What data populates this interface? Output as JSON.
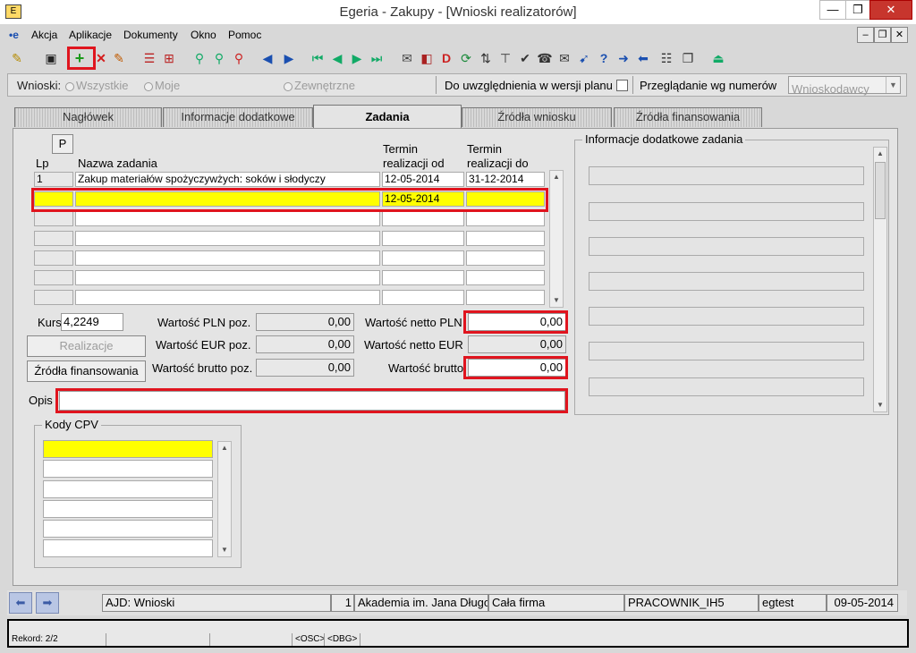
{
  "window": {
    "title": "Egeria - Zakupy - [Wnioski realizatorów]",
    "minimize": "—",
    "restore": "❐",
    "close": "✕"
  },
  "menu": [
    "Akcja",
    "Aplikacje",
    "Dokumenty",
    "Okno",
    "Pomoc"
  ],
  "mdi": {
    "minimize": "–",
    "restore": "❐",
    "close": "✕"
  },
  "filter": {
    "label": "Wnioski:",
    "opt_all": "Wszystkie",
    "opt_mine": "Moje",
    "opt_external": "Zewnętrzne",
    "plan_label": "Do uwzględnienia w wersji planu",
    "browse_label": "Przeglądanie wg numerów",
    "browse_value": "Wnioskodawcy"
  },
  "tabs": [
    "Nagłówek",
    "Informacje dodatkowe",
    "Zadania",
    "Źródła wniosku",
    "Źródła finansowania"
  ],
  "tasks": {
    "p_button": "P",
    "col_lp": "Lp",
    "col_name": "Nazwa zadania",
    "col_from_1": "Termin",
    "col_from_2": "realizacji od",
    "col_to_1": "Termin",
    "col_to_2": "realizacji do",
    "rows": [
      {
        "lp": "1",
        "name": "Zakup materiałów spożyczywżych: soków i słodyczy",
        "from": "12-05-2014",
        "to": "31-12-2014"
      },
      {
        "lp": "",
        "name": "",
        "from": "12-05-2014",
        "to": ""
      },
      {
        "lp": "",
        "name": "",
        "from": "",
        "to": ""
      },
      {
        "lp": "",
        "name": "",
        "from": "",
        "to": ""
      },
      {
        "lp": "",
        "name": "",
        "from": "",
        "to": ""
      },
      {
        "lp": "",
        "name": "",
        "from": "",
        "to": ""
      }
    ]
  },
  "values": {
    "kurs_label": "Kurs",
    "kurs": "4,2249",
    "pln_poz_label": "Wartość PLN poz.",
    "pln_poz": "0,00",
    "eur_poz_label": "Wartość EUR poz.",
    "eur_poz": "0,00",
    "brutto_poz_label": "Wartość brutto poz.",
    "brutto_poz": "0,00",
    "netto_pln_label": "Wartość netto PLN",
    "netto_pln": "0,00",
    "netto_eur_label": "Wartość netto EUR",
    "netto_eur": "0,00",
    "brutto_label": "Wartość brutto",
    "brutto": "0,00",
    "realizacje_button": "Realizacje",
    "zrodla_button": "Źródła finansowania",
    "opis_label": "Opis",
    "opis": ""
  },
  "info_group": {
    "title": "Informacje dodatkowe zadania"
  },
  "cpv_group": {
    "title": "Kody CPV"
  },
  "status": {
    "ajd": "AJD: Wnioski",
    "num": "1",
    "org": "Akademia im. Jana Długosza",
    "firm": "Cała firma",
    "role": "PRACOWNIK_IH5",
    "user": "egtest",
    "date": "09-05-2014"
  },
  "bottom": {
    "record": "Rekord: 2/2",
    "osc": "<OSC>",
    "dbg": "<DBG>"
  },
  "colors": {
    "highlight": "#ffff00",
    "red_marker": "#e0141e",
    "panel_bg": "#e4e4e4"
  }
}
